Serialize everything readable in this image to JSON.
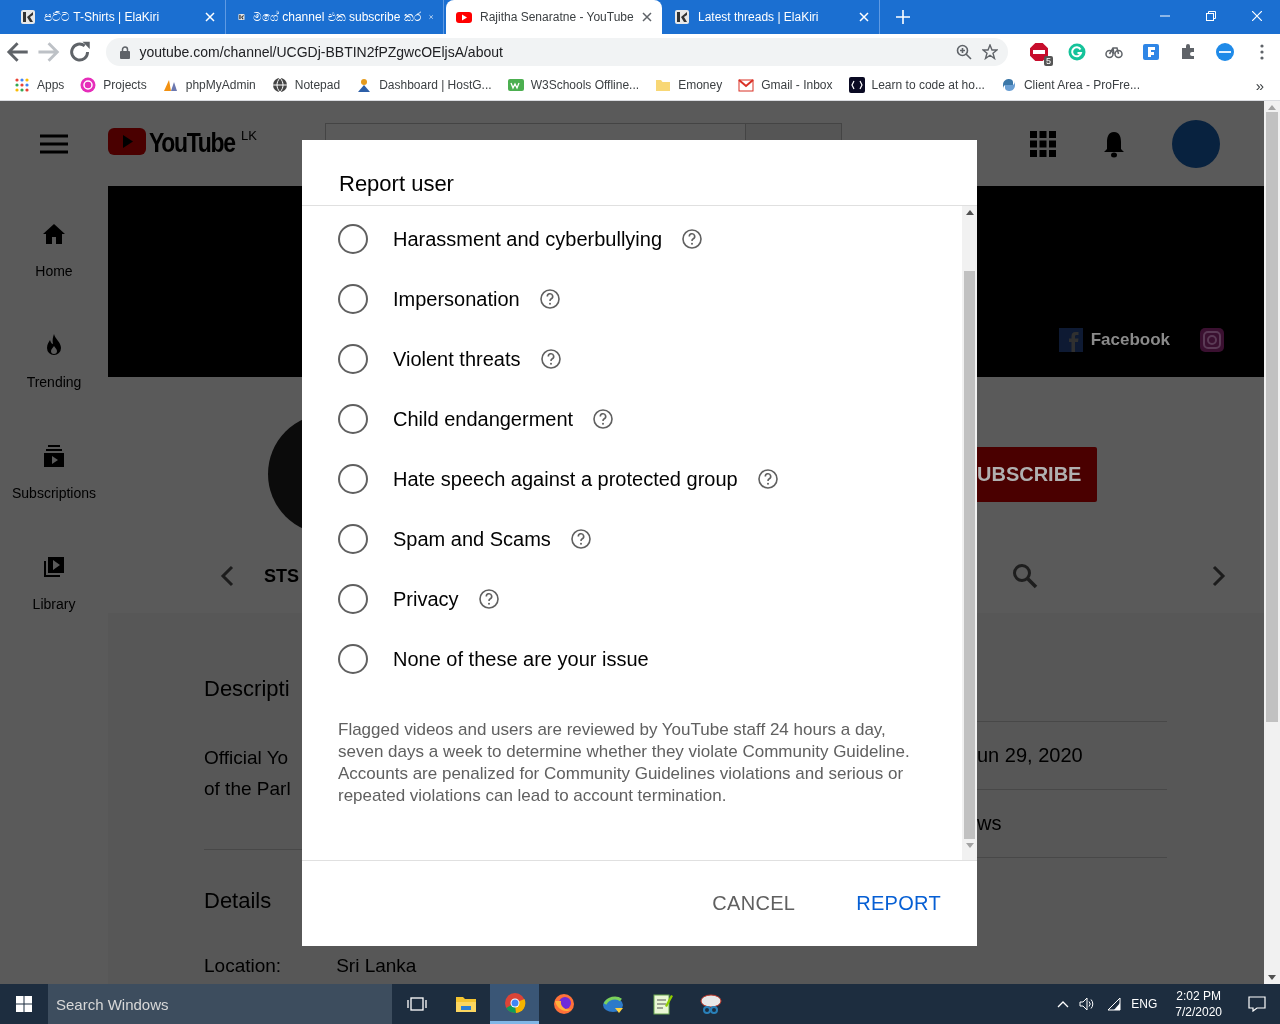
{
  "browser": {
    "tabs": [
      {
        "title": "පට්ට T-Shirts | ElaKiri",
        "selected": false
      },
      {
        "title": "මගේ channel එක subscribe කර",
        "selected": false
      },
      {
        "title": "Rajitha Senaratne - YouTube",
        "selected": true
      },
      {
        "title": "Latest threads | ElaKiri",
        "selected": false
      }
    ],
    "address": "youtube.com/channel/UCGDj-BBTIN2fPZgwcOEljsA/about",
    "extension_badge": "5",
    "bookmarks": [
      "Apps",
      "Projects",
      "phpMyAdmin",
      "Notepad",
      "Dashboard | HostG...",
      "W3Schools Offline...",
      "Emoney",
      "Gmail - Inbox",
      "Learn to code at ho...",
      "Client Area - ProFre..."
    ],
    "more_bookmarks": "»"
  },
  "youtube": {
    "logo": "YouTube",
    "region": "LK",
    "sidebar": [
      "Home",
      "Trending",
      "Subscriptions",
      "Library"
    ],
    "banner_link": "Facebook",
    "channel_name": "STS",
    "subscribe_button": "UBSCRIBE",
    "description_heading": "Descripti",
    "description_lines": [
      "Official Yo",
      "of the Parl"
    ],
    "details_heading": "Details",
    "location_label": "Location:",
    "location": "Sri Lanka",
    "stats": [
      "un 29, 2020",
      "ws"
    ]
  },
  "dialog": {
    "title": "Report user",
    "options": [
      {
        "label": "Harassment and cyberbullying",
        "selected": false,
        "help": true
      },
      {
        "label": "Impersonation",
        "selected": false,
        "help": true
      },
      {
        "label": "Violent threats",
        "selected": false,
        "help": true
      },
      {
        "label": "Child endangerment",
        "selected": false,
        "help": true
      },
      {
        "label": "Hate speech against a protected group",
        "selected": false,
        "help": true
      },
      {
        "label": "Spam and Scams",
        "selected": false,
        "help": true
      },
      {
        "label": "Privacy",
        "selected": false,
        "help": true
      },
      {
        "label": "None of these are your issue",
        "selected": false,
        "help": false
      }
    ],
    "note": "Flagged videos and users are reviewed by YouTube staff 24 hours a day, seven days a week to determine whether they violate Community Guideline. Accounts are penalized for Community Guidelines violations and serious or repeated violations can lead to account termination.",
    "buttons": [
      {
        "label": "CANCEL",
        "kind": "secondary"
      },
      {
        "label": "REPORT",
        "kind": "primary"
      }
    ]
  },
  "taskbar": {
    "search_placeholder": "Search Windows",
    "apps": [
      {
        "selected": false
      },
      {
        "selected": true
      },
      {
        "selected": false
      },
      {
        "selected": false
      },
      {
        "selected": false
      },
      {
        "selected": false
      }
    ],
    "language": "ENG",
    "time": "2:02 PM",
    "date": "7/2/2020"
  }
}
